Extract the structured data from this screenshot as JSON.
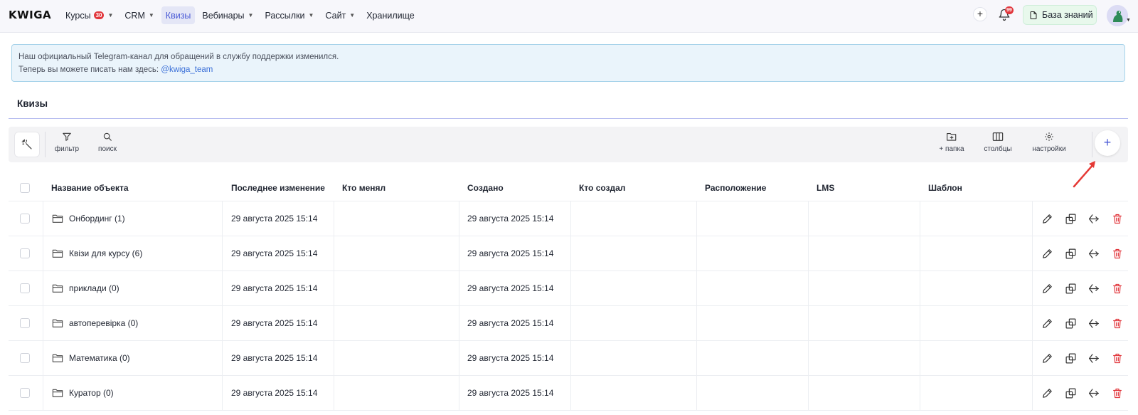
{
  "app": {
    "logo": "KWIGA"
  },
  "nav": {
    "items": [
      {
        "label": "Курсы",
        "badge": "30",
        "chevron": true,
        "active": false
      },
      {
        "label": "CRM",
        "badge": null,
        "chevron": true,
        "active": false
      },
      {
        "label": "Квизы",
        "badge": null,
        "chevron": false,
        "active": true
      },
      {
        "label": "Вебинары",
        "badge": null,
        "chevron": true,
        "active": false
      },
      {
        "label": "Рассылки",
        "badge": null,
        "chevron": true,
        "active": false
      },
      {
        "label": "Сайт",
        "badge": null,
        "chevron": true,
        "active": false
      },
      {
        "label": "Хранилище",
        "badge": null,
        "chevron": false,
        "active": false
      }
    ],
    "plus": "+",
    "notifications_badge": "99",
    "knowledge_base": "База знаний"
  },
  "banner": {
    "line1": "Наш официальный Telegram-канал для обращений в службу поддержки изменился.",
    "line2_prefix": "Теперь вы можете писать нам здесь:",
    "line2_link": "@kwiga_team"
  },
  "page": {
    "title": "Квизы"
  },
  "toolbar": {
    "filter": "фильтр",
    "search": "поиск",
    "add_folder": "+ папка",
    "columns": "столбцы",
    "settings": "настройки",
    "add": "+"
  },
  "table": {
    "headers": {
      "name": "Название объекта",
      "modified": "Последнее изменение",
      "modified_by": "Кто менял",
      "created": "Создано",
      "created_by": "Кто создал",
      "location": "Расположение",
      "lms": "LMS",
      "template": "Шаблон"
    },
    "rows": [
      {
        "name": "Онбординг (1)",
        "modified": "29 августа 2025 15:14",
        "created": "29 августа 2025 15:14"
      },
      {
        "name": "Квізи для курсу (6)",
        "modified": "29 августа 2025 15:14",
        "created": "29 августа 2025 15:14"
      },
      {
        "name": "приклади (0)",
        "modified": "29 августа 2025 15:14",
        "created": "29 августа 2025 15:14"
      },
      {
        "name": "автоперевірка (0)",
        "modified": "29 августа 2025 15:14",
        "created": "29 августа 2025 15:14"
      },
      {
        "name": "Математика (0)",
        "modified": "29 августа 2025 15:14",
        "created": "29 августа 2025 15:14"
      },
      {
        "name": "Куратор (0)",
        "modified": "29 августа 2025 15:14",
        "created": "29 августа 2025 15:14"
      }
    ]
  },
  "colors": {
    "accent": "#4a5ad6",
    "danger": "#e1363c",
    "annotation_arrow": "#e53935"
  }
}
